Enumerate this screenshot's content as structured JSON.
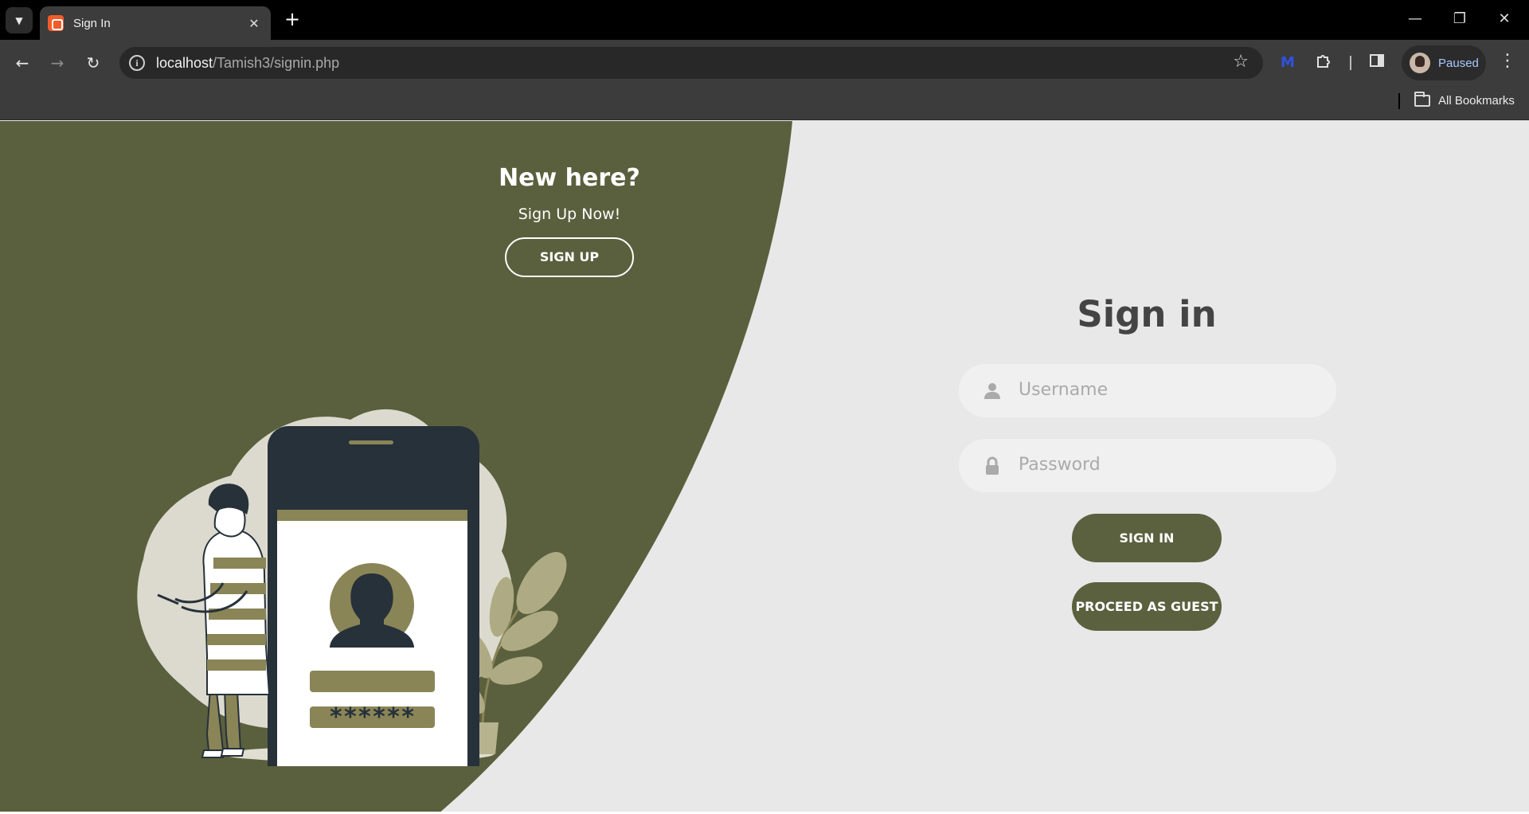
{
  "browser": {
    "tab_title": "Sign In",
    "tab_close": "✕",
    "new_tab": "+",
    "url_host": "localhost",
    "url_path": "/Tamish3/signin.php",
    "profile_status": "Paused",
    "bookmarks_label": "All Bookmarks",
    "window_controls": {
      "minimize": "—",
      "restore": "❐",
      "close": "✕"
    }
  },
  "page": {
    "panel": {
      "heading": "New here?",
      "subheading": "Sign Up Now!",
      "signup_button": "SIGN UP"
    },
    "illustration": {
      "password_mask": "******"
    },
    "form": {
      "title": "Sign in",
      "username_placeholder": "Username",
      "password_placeholder": "Password",
      "signin_button": "SIGN IN",
      "guest_button": "PROCEED AS GUEST"
    }
  },
  "colors": {
    "panel_green": "#5a603d",
    "accent_olive": "#8a8557",
    "button_green": "#5b613e",
    "page_bg": "#e8e8e8",
    "phone_dark": "#27313a"
  },
  "icons": [
    "tab-list-icon",
    "favicon-icon",
    "back-arrow-icon",
    "forward-arrow-icon",
    "reload-icon",
    "site-info-icon",
    "bookmark-star-icon",
    "extension-m-icon",
    "extensions-puzzle-icon",
    "side-panel-icon",
    "avatar",
    "more-menu-icon",
    "folder-icon",
    "user-icon",
    "lock-icon"
  ]
}
